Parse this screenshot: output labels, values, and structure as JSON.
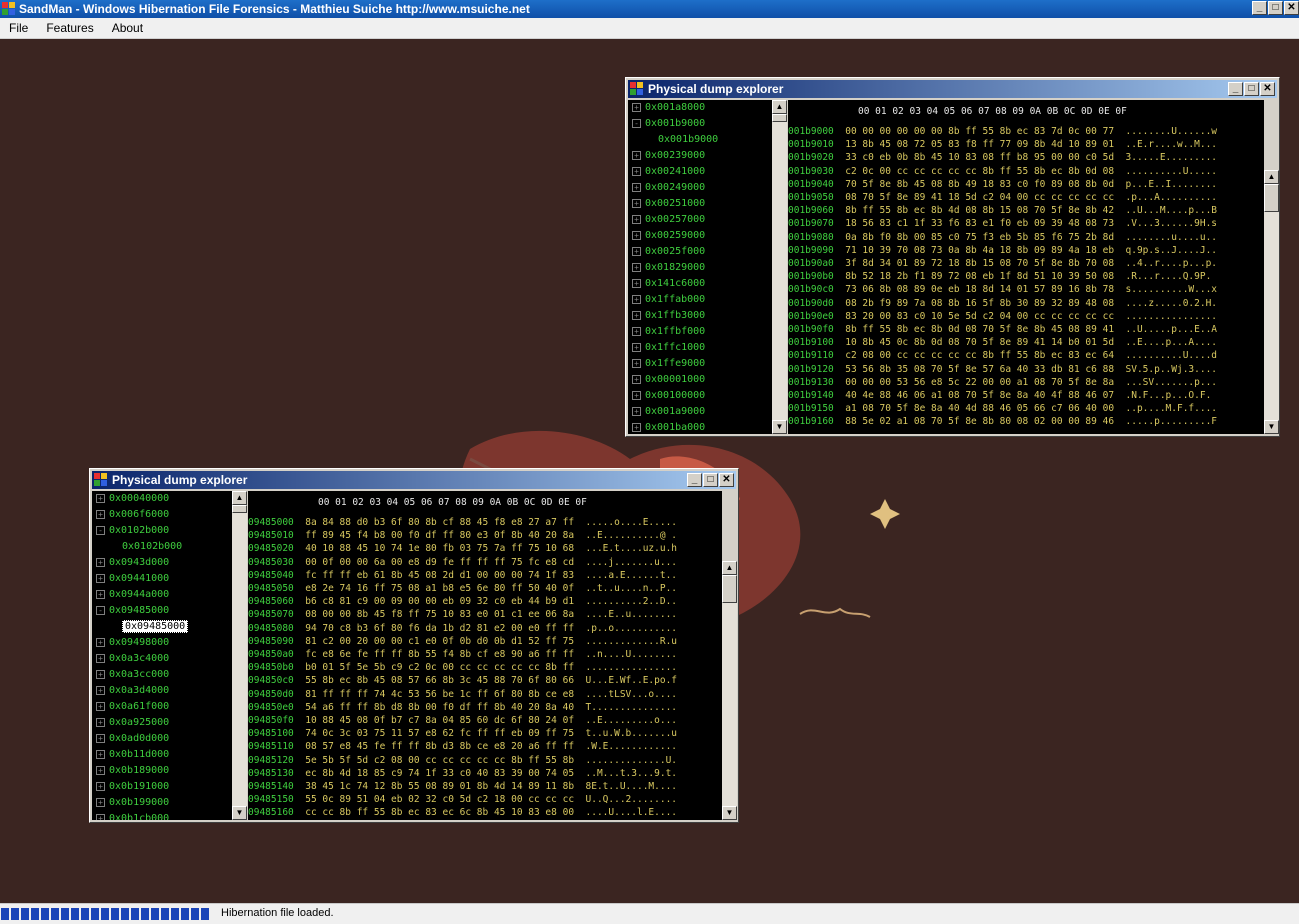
{
  "app": {
    "title": "SandMan - Windows Hibernation File Forensics - Matthieu Suiche http://www.msuiche.net",
    "min": "_",
    "max": "□",
    "close": "✕"
  },
  "menu": [
    "File",
    "Features",
    "About"
  ],
  "status": {
    "text": "Hibernation file loaded."
  },
  "windows": [
    {
      "title": "Physical dump explorer",
      "header": "00 01 02 03 04 05 06 07 08 09 0A 0B 0C 0D 0E 0F",
      "tree": [
        {
          "label": "0x001a8000",
          "state": "+"
        },
        {
          "label": "0x001b9000",
          "state": "-"
        },
        {
          "label": "0x001b9000",
          "child": true
        },
        {
          "label": "0x00239000",
          "state": "+"
        },
        {
          "label": "0x00241000",
          "state": "+"
        },
        {
          "label": "0x00249000",
          "state": "+"
        },
        {
          "label": "0x00251000",
          "state": "+"
        },
        {
          "label": "0x00257000",
          "state": "+"
        },
        {
          "label": "0x00259000",
          "state": "+"
        },
        {
          "label": "0x0025f000",
          "state": "+"
        },
        {
          "label": "0x01829000",
          "state": "+"
        },
        {
          "label": "0x141c6000",
          "state": "+"
        },
        {
          "label": "0x1ffab000",
          "state": "+"
        },
        {
          "label": "0x1ffb3000",
          "state": "+"
        },
        {
          "label": "0x1ffbf000",
          "state": "+"
        },
        {
          "label": "0x1ffc1000",
          "state": "+"
        },
        {
          "label": "0x1ffe9000",
          "state": "+"
        },
        {
          "label": "0x00001000",
          "state": "+"
        },
        {
          "label": "0x00100000",
          "state": "+"
        },
        {
          "label": "0x001a9000",
          "state": "+"
        },
        {
          "label": "0x001ba000",
          "state": "+"
        }
      ],
      "hex": [
        [
          "001b9000",
          "00 00 00 00 00 00 8b ff 55 8b ec 83 7d 0c 00 77",
          "........U......w"
        ],
        [
          "001b9010",
          "13 8b 45 08 72 05 83 f8 ff 77 09 8b 4d 10 89 01",
          "..E.r....w..M..."
        ],
        [
          "001b9020",
          "33 c0 eb 0b 8b 45 10 83 08 ff b8 95 00 00 c0 5d",
          "3.....E........."
        ],
        [
          "001b9030",
          "c2 0c 00 cc cc cc cc cc 8b ff 55 8b ec 8b 0d 08",
          "..........U....."
        ],
        [
          "001b9040",
          "70 5f 8e 8b 45 08 8b 49 18 83 c0 f0 89 08 8b 0d",
          "p...E..I........"
        ],
        [
          "001b9050",
          "08 70 5f 8e 89 41 18 5d c2 04 00 cc cc cc cc cc",
          ".p...A.........."
        ],
        [
          "001b9060",
          "8b ff 55 8b ec 8b 4d 08 8b 15 08 70 5f 8e 8b 42",
          "..U...M....p...B"
        ],
        [
          "001b9070",
          "18 56 83 c1 1f 33 f6 83 e1 f0 eb 09 39 48 08 73",
          ".V...3......9H.s"
        ],
        [
          "001b9080",
          "0a 8b f0 8b 00 85 c0 75 f3 eb 5b 85 f6 75 2b 8d",
          "........u....u.."
        ],
        [
          "001b9090",
          "71 10 39 70 08 73 0a 8b 4a 18 8b 09 89 4a 18 eb",
          "q.9p.s..J....J.."
        ],
        [
          "001b90a0",
          "3f 8d 34 01 89 72 18 8b 15 08 70 5f 8e 8b 70 08",
          "..4..r....p...p."
        ],
        [
          "001b90b0",
          "8b 52 18 2b f1 89 72 08 eb 1f 8d 51 10 39 50 08",
          ".R...r....Q.9P."
        ],
        [
          "001b90c0",
          "73 06 8b 08 89 0e eb 18 8d 14 01 57 89 16 8b 78",
          "s..........W...x"
        ],
        [
          "001b90d0",
          "08 2b f9 89 7a 08 8b 16 5f 8b 30 89 32 89 48 08",
          "....z.....0.2.H."
        ],
        [
          "001b90e0",
          "83 20 00 83 c0 10 5e 5d c2 04 00 cc cc cc cc cc",
          "................"
        ],
        [
          "001b90f0",
          "8b ff 55 8b ec 8b 0d 08 70 5f 8e 8b 45 08 89 41",
          "..U.....p...E..A"
        ],
        [
          "001b9100",
          "10 8b 45 0c 8b 0d 08 70 5f 8e 89 41 14 b0 01 5d",
          "..E....p...A...."
        ],
        [
          "001b9110",
          "c2 08 00 cc cc cc cc cc 8b ff 55 8b ec 83 ec 64",
          "..........U....d"
        ],
        [
          "001b9120",
          "53 56 8b 35 08 70 5f 8e 57 6a 40 33 db 81 c6 88",
          "SV.5.p..Wj.3...."
        ],
        [
          "001b9130",
          "00 00 00 53 56 e8 5c 22 00 00 a1 08 70 5f 8e 8a",
          "...SV.......p..."
        ],
        [
          "001b9140",
          "40 4e 88 46 06 a1 08 70 5f 8e 8a 40 4f 88 46 07",
          ".N.F...p...O.F."
        ],
        [
          "001b9150",
          "a1 08 70 5f 8e 8a 40 4d 88 46 05 66 c7 06 40 00",
          "..p....M.F.f...."
        ],
        [
          "001b9160",
          "88 5e 02 a1 08 70 5f 8e 8b 80 08 02 00 00 89 46",
          ".....p.........F"
        ]
      ]
    },
    {
      "title": "Physical dump explorer",
      "header": "00 01 02 03 04 05 06 07 08 09 0A 0B 0C 0D 0E 0F",
      "tree": [
        {
          "label": "0x00040000",
          "state": "+"
        },
        {
          "label": "0x006f6000",
          "state": "+"
        },
        {
          "label": "0x0102b000",
          "state": "-"
        },
        {
          "label": "0x0102b000",
          "child": true
        },
        {
          "label": "0x0943d000",
          "state": "+"
        },
        {
          "label": "0x09441000",
          "state": "+"
        },
        {
          "label": "0x0944a000",
          "state": "+"
        },
        {
          "label": "0x09485000",
          "state": "-"
        },
        {
          "label": "0x09485000",
          "child": true,
          "selected": true
        },
        {
          "label": "0x09498000",
          "state": "+"
        },
        {
          "label": "0x0a3c4000",
          "state": "+"
        },
        {
          "label": "0x0a3cc000",
          "state": "+"
        },
        {
          "label": "0x0a3d4000",
          "state": "+"
        },
        {
          "label": "0x0a61f000",
          "state": "+"
        },
        {
          "label": "0x0a925000",
          "state": "+"
        },
        {
          "label": "0x0ad0d000",
          "state": "+"
        },
        {
          "label": "0x0b11d000",
          "state": "+"
        },
        {
          "label": "0x0b189000",
          "state": "+"
        },
        {
          "label": "0x0b191000",
          "state": "+"
        },
        {
          "label": "0x0b199000",
          "state": "+"
        },
        {
          "label": "0x0b1cb000",
          "state": "+"
        }
      ],
      "hex": [
        [
          "09485000",
          "8a 84 88 d0 b3 6f 80 8b cf 88 45 f8 e8 27 a7 ff",
          ".....o....E....."
        ],
        [
          "09485010",
          "ff 89 45 f4 b8 00 f0 df ff 80 e3 0f 8b 40 20 8a",
          "..E..........@ ."
        ],
        [
          "09485020",
          "40 10 88 45 10 74 1e 80 fb 03 75 7a ff 75 10 68",
          "...E.t....uz.u.h"
        ],
        [
          "09485030",
          "00 0f 00 00 6a 00 e8 d9 fe ff ff ff 75 fc e8 cd",
          "....j.......u..."
        ],
        [
          "09485040",
          "fc ff ff eb 61 8b 45 08 2d d1 00 00 00 74 1f 83",
          "....a.E......t.."
        ],
        [
          "09485050",
          "e8 2e 74 16 ff 75 08 a1 b8 e5 6e 80 ff 50 40 0f",
          "..t..u....n..P.."
        ],
        [
          "09485060",
          "b6 c8 81 c9 00 09 00 00 eb 09 32 c0 eb 44 b9 d1",
          "..........2..D.."
        ],
        [
          "09485070",
          "08 00 00 8b 45 f8 ff 75 10 83 e0 01 c1 ee 06 8a",
          "....E..u........"
        ],
        [
          "09485080",
          "94 70 c8 b3 6f 80 f6 da 1b d2 81 e2 00 e0 ff ff",
          ".p..o..........."
        ],
        [
          "09485090",
          "81 c2 00 20 00 00 c1 e0 0f 0b d0 0b d1 52 ff 75",
          ".............R.u"
        ],
        [
          "094850a0",
          "fc e8 6e fe ff ff 8b 55 f4 8b cf e8 90 a6 ff ff",
          "..n....U........"
        ],
        [
          "094850b0",
          "b0 01 5f 5e 5b c9 c2 0c 00 cc cc cc cc cc 8b ff",
          "................"
        ],
        [
          "094850c0",
          "55 8b ec 8b 45 08 57 66 8b 3c 45 88 70 6f 80 66",
          "U...E.Wf..E.po.f"
        ],
        [
          "094850d0",
          "81 ff ff ff 74 4c 53 56 be 1c ff 6f 80 8b ce e8",
          "....tLSV...o...."
        ],
        [
          "094850e0",
          "54 a6 ff ff 8b d8 8b 00 f0 df ff 8b 40 20 8a 40",
          "T..............."
        ],
        [
          "094850f0",
          "10 88 45 08 0f b7 c7 8a 04 85 60 dc 6f 80 24 0f",
          "..E.........o..."
        ],
        [
          "09485100",
          "74 0c 3c 03 75 11 57 e8 62 fc ff ff eb 09 ff 75",
          "t..u.W.b.......u"
        ],
        [
          "09485110",
          "08 57 e8 45 fe ff ff 8b d3 8b ce e8 20 a6 ff ff",
          ".W.E............"
        ],
        [
          "09485120",
          "5e 5b 5f 5d c2 08 00 cc cc cc cc cc 8b ff 55 8b",
          "..............U."
        ],
        [
          "09485130",
          "ec 8b 4d 18 85 c9 74 1f 33 c0 40 83 39 00 74 05",
          "..M...t.3...9.t."
        ],
        [
          "09485140",
          "38 45 1c 74 12 8b 55 08 89 01 8b 4d 14 89 11 8b",
          "8E.t..U....M...."
        ],
        [
          "09485150",
          "55 0c 89 51 04 eb 02 32 c0 5d c2 18 00 cc cc cc",
          "U..Q...2........"
        ],
        [
          "09485160",
          "cc cc 8b ff 55 8b ec 83 ec 6c 8b 45 10 83 e8 00",
          "....U....l.E...."
        ]
      ]
    }
  ]
}
